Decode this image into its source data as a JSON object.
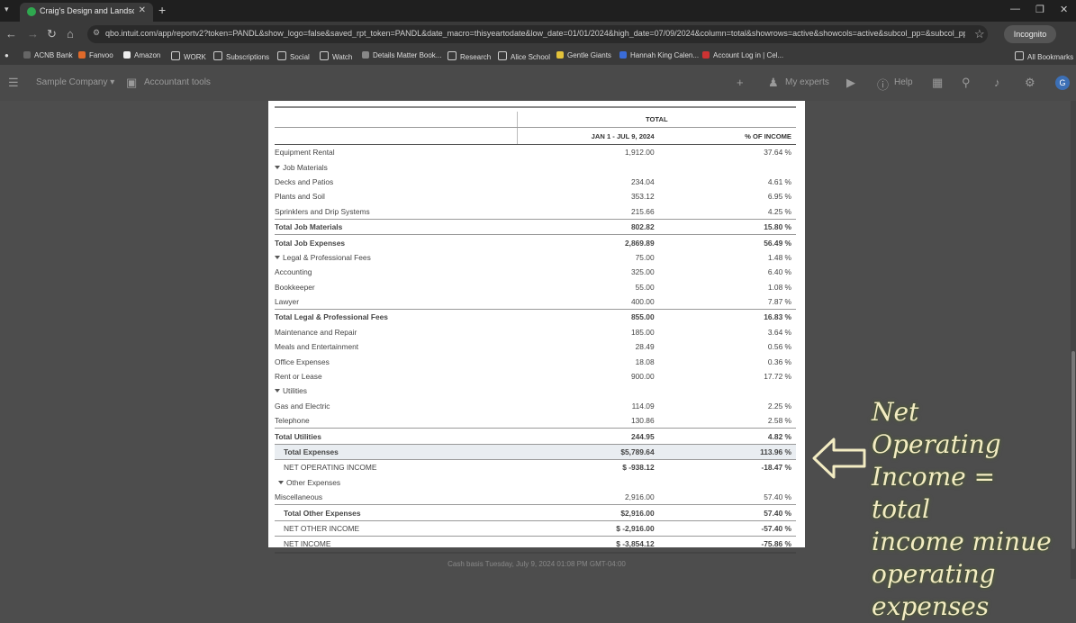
{
  "browser": {
    "tab_title": "Craig's Design and Landscapin",
    "url": "qbo.intuit.com/app/reportv2?token=PANDL&show_logo=false&saved_rpt_token=PANDL&date_macro=thisyeartodate&low_date=01/01/2024&high_date=07/09/2024&column=total&showrows=active&showcols=active&subcol_pp=&subcol_pp_c...",
    "incognito_label": "Incognito",
    "bookmarks": [
      "ACNB Bank",
      "Fanvoo",
      "Amazon",
      "WORK",
      "Subscriptions",
      "Social",
      "Watch",
      "Details Matter Book...",
      "Research",
      "Alice School",
      "Gentle Giants",
      "Hannah King Calen...",
      "Account Log in | Cel...",
      "All Bookmarks"
    ]
  },
  "qb_header": {
    "company": "Sample Company",
    "accountant_tools": "Accountant tools",
    "my_experts": "My experts",
    "help": "Help",
    "avatar_initial": "G"
  },
  "report": {
    "col_group": "TOTAL",
    "col_period": "JAN 1 - JUL 9, 2024",
    "col_pct": "% OF INCOME",
    "rows": [
      {
        "label": "Equipment Rental",
        "amount": "1,912.00",
        "pct": "37.64 %"
      },
      {
        "label": "Job Materials",
        "amount": "",
        "pct": ""
      },
      {
        "label": "Decks and Patios",
        "amount": "234.04",
        "pct": "4.61 %"
      },
      {
        "label": "Plants and Soil",
        "amount": "353.12",
        "pct": "6.95 %"
      },
      {
        "label": "Sprinklers and Drip Systems",
        "amount": "215.66",
        "pct": "4.25 %"
      },
      {
        "label": "Total Job Materials",
        "amount": "802.82",
        "pct": "15.80 %"
      },
      {
        "label": "Total Job Expenses",
        "amount": "2,869.89",
        "pct": "56.49 %"
      },
      {
        "label": "Legal & Professional Fees",
        "amount": "75.00",
        "pct": "1.48 %"
      },
      {
        "label": "Accounting",
        "amount": "325.00",
        "pct": "6.40 %"
      },
      {
        "label": "Bookkeeper",
        "amount": "55.00",
        "pct": "1.08 %"
      },
      {
        "label": "Lawyer",
        "amount": "400.00",
        "pct": "7.87 %"
      },
      {
        "label": "Total Legal & Professional Fees",
        "amount": "855.00",
        "pct": "16.83 %"
      },
      {
        "label": "Maintenance and Repair",
        "amount": "185.00",
        "pct": "3.64 %"
      },
      {
        "label": "Meals and Entertainment",
        "amount": "28.49",
        "pct": "0.56 %"
      },
      {
        "label": "Office Expenses",
        "amount": "18.08",
        "pct": "0.36 %"
      },
      {
        "label": "Rent or Lease",
        "amount": "900.00",
        "pct": "17.72 %"
      },
      {
        "label": "Utilities",
        "amount": "",
        "pct": ""
      },
      {
        "label": "Gas and Electric",
        "amount": "114.09",
        "pct": "2.25 %"
      },
      {
        "label": "Telephone",
        "amount": "130.86",
        "pct": "2.58 %"
      },
      {
        "label": "Total Utilities",
        "amount": "244.95",
        "pct": "4.82 %"
      },
      {
        "label": "Total Expenses",
        "amount": "$5,789.64",
        "pct": "113.96 %"
      },
      {
        "label": "NET OPERATING INCOME",
        "amount": "$ -938.12",
        "pct": "-18.47 %"
      },
      {
        "label": "Other Expenses",
        "amount": "",
        "pct": ""
      },
      {
        "label": "Miscellaneous",
        "amount": "2,916.00",
        "pct": "57.40 %"
      },
      {
        "label": "Total Other Expenses",
        "amount": "$2,916.00",
        "pct": "57.40 %"
      },
      {
        "label": "NET OTHER INCOME",
        "amount": "$ -2,916.00",
        "pct": "-57.40 %"
      },
      {
        "label": "NET INCOME",
        "amount": "$ -3,854.12",
        "pct": "-75.86 %"
      }
    ],
    "footer": "Cash basis  Tuesday, July 9, 2024  01:08 PM GMT-04:00"
  },
  "annotation": [
    "Net Operating",
    "Income = total",
    "income minue",
    "operating",
    "expenses"
  ],
  "colors": {
    "annotation_text": "#f3ecc3",
    "annotation_glow": "#5a6b33",
    "avatar": "#3c6fb5"
  }
}
